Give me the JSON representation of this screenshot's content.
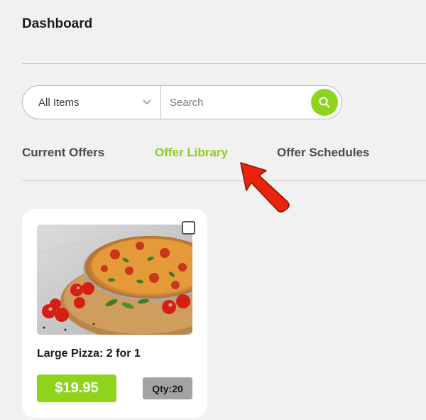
{
  "header": {
    "title": "Dashboard"
  },
  "filter": {
    "selected": "All Items",
    "search_placeholder": "Search"
  },
  "tabs": [
    {
      "label": "Current Offers",
      "active": false
    },
    {
      "label": "Offer Library",
      "active": true
    },
    {
      "label": "Offer Schedules",
      "active": false
    }
  ],
  "card": {
    "title": "Large Pizza: 2 for 1",
    "price": "$19.95",
    "qty": "Qty:20",
    "image": "pizza-photo"
  },
  "icons": {
    "search": "search-icon",
    "dropdown": "chevron-down-icon",
    "annotation": "red-arrow-icon"
  },
  "colors": {
    "accent": "#8fd41c",
    "active_tab": "#8ccf1c",
    "arrow": "#e8240c",
    "qty_badge": "#a3a3a3"
  }
}
